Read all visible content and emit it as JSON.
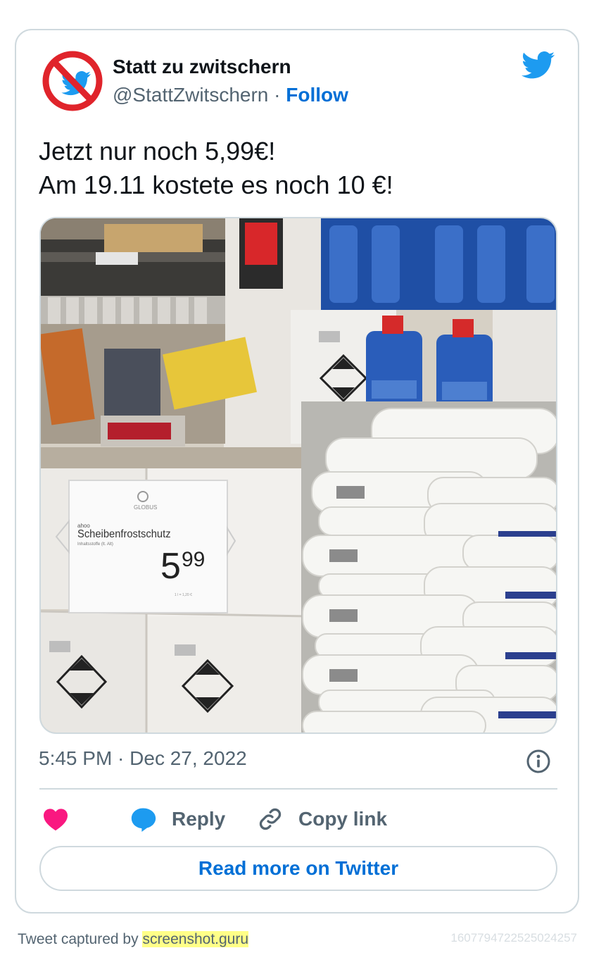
{
  "author": {
    "name": "Statt zu zwitschern",
    "handle": "@StattZwitschern",
    "separator": "·",
    "follow_label": "Follow"
  },
  "tweet": {
    "lines": [
      "Jetzt nur noch 5,99€!",
      "Am 19.11 kostete es noch 10 €!"
    ],
    "timestamp": "5:45 PM · Dec 27, 2022"
  },
  "photo": {
    "price_sign_brand": "GLOBUS",
    "price_sign_small": "ahoo",
    "price_sign_product": "Scheibenfrostschutz",
    "price_sign_subline": "Inhaltsstoffe (lt. Alt)",
    "price_main": "5",
    "price_cents": "99",
    "price_unit": "1 l = 1,20 €"
  },
  "actions": {
    "like_icon": "heart-icon",
    "reply_label": "Reply",
    "copy_link_label": "Copy link"
  },
  "read_more_label": "Read more on Twitter",
  "footer": {
    "captured_prefix": "Tweet captured by ",
    "captured_site": "screenshot.guru",
    "tweet_id": "1607794722525024257"
  },
  "colors": {
    "link_blue": "#006fd6",
    "twitter_blue": "#1d9bf0",
    "like_pink": "#f91880",
    "muted": "#536471",
    "border": "#cfd9de",
    "highlight": "#ffff88"
  }
}
